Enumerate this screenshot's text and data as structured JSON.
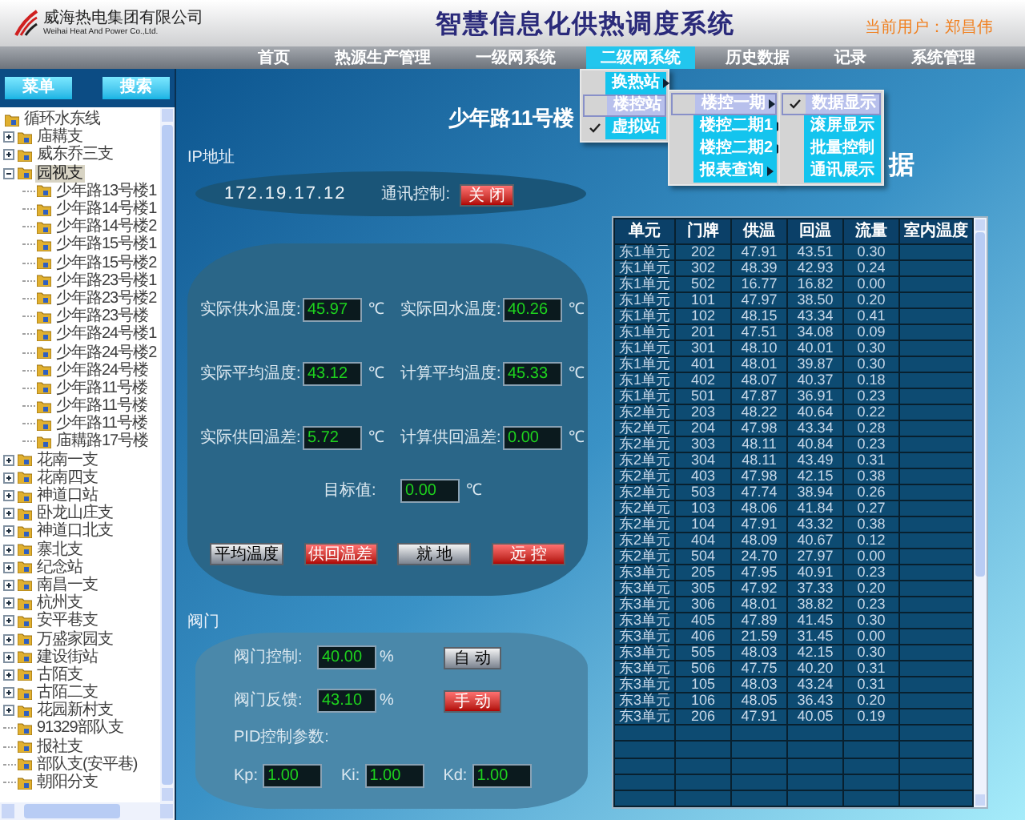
{
  "header": {
    "company_name": "威海热电集团有限公司",
    "company_name_en": "Weihai Heat And Power Co.,Ltd.",
    "title": "智慧信息化供热调度系统",
    "current_user": "当前用户：郑昌伟"
  },
  "nav": [
    {
      "label": "首页",
      "selected": false
    },
    {
      "label": "热源生产管理",
      "selected": false
    },
    {
      "label": "一级网系统",
      "selected": false
    },
    {
      "label": "二级网系统",
      "selected": true
    },
    {
      "label": "历史数据",
      "selected": false
    },
    {
      "label": "记录",
      "selected": false
    },
    {
      "label": "系统管理",
      "selected": false
    }
  ],
  "menus": [
    {
      "items": [
        {
          "label": "换热站",
          "selected": false,
          "checked": false,
          "submenu": true
        },
        {
          "label": "楼控站",
          "selected": true,
          "checked": false,
          "submenu": false
        },
        {
          "label": "虚拟站",
          "selected": false,
          "checked": true,
          "submenu": false
        }
      ]
    },
    {
      "items": [
        {
          "label": "楼控一期",
          "selected": true,
          "checked": false,
          "submenu": true
        },
        {
          "label": "楼控二期1",
          "selected": false,
          "checked": false,
          "submenu": true
        },
        {
          "label": "楼控二期2",
          "selected": false,
          "checked": false,
          "submenu": true
        },
        {
          "label": "报表查询",
          "selected": false,
          "checked": false,
          "submenu": true
        }
      ]
    },
    {
      "items": [
        {
          "label": "数据显示",
          "selected": true,
          "checked": true,
          "submenu": false
        },
        {
          "label": "滚屏显示",
          "selected": false,
          "checked": false,
          "submenu": false
        },
        {
          "label": "批量控制",
          "selected": false,
          "checked": false,
          "submenu": false
        },
        {
          "label": "通讯展示",
          "selected": false,
          "checked": false,
          "submenu": false
        }
      ]
    }
  ],
  "sidebar": {
    "buttons": [
      "菜单",
      "搜索"
    ],
    "tree": {
      "label": "循环水东线",
      "selected": false,
      "children": [
        {
          "label": "庙耩支",
          "kind": "branch",
          "expanded": false,
          "selected": false
        },
        {
          "label": "威东乔三支",
          "kind": "branch",
          "expanded": false,
          "selected": false
        },
        {
          "label": "园视支",
          "kind": "branch",
          "expanded": true,
          "selected": true,
          "children": [
            {
              "label": "少年路13号楼1",
              "kind": "leaf",
              "selected": false
            },
            {
              "label": "少年路14号楼1",
              "kind": "leaf",
              "selected": false
            },
            {
              "label": "少年路14号楼2",
              "kind": "leaf",
              "selected": false
            },
            {
              "label": "少年路15号楼1",
              "kind": "leaf",
              "selected": false
            },
            {
              "label": "少年路15号楼2",
              "kind": "leaf",
              "selected": false
            },
            {
              "label": "少年路23号楼1",
              "kind": "leaf",
              "selected": false
            },
            {
              "label": "少年路23号楼2",
              "kind": "leaf",
              "selected": false
            },
            {
              "label": "少年路23号楼",
              "kind": "leaf",
              "selected": false
            },
            {
              "label": "少年路24号楼1",
              "kind": "leaf",
              "selected": false
            },
            {
              "label": "少年路24号楼2",
              "kind": "leaf",
              "selected": false
            },
            {
              "label": "少年路24号楼",
              "kind": "leaf",
              "selected": false
            },
            {
              "label": "少年路11号楼",
              "kind": "leaf",
              "selected": false
            },
            {
              "label": "少年路11号楼",
              "kind": "leaf",
              "selected": false
            },
            {
              "label": "少年路11号楼",
              "kind": "leaf",
              "selected": false
            },
            {
              "label": "庙耩路17号楼",
              "kind": "leaf",
              "selected": false
            }
          ]
        },
        {
          "label": "花南一支",
          "kind": "branch",
          "expanded": false,
          "selected": false
        },
        {
          "label": "花南四支",
          "kind": "branch",
          "expanded": false,
          "selected": false
        },
        {
          "label": "神道口站",
          "kind": "branch",
          "expanded": false,
          "selected": false
        },
        {
          "label": "卧龙山庄支",
          "kind": "branch",
          "expanded": false,
          "selected": false
        },
        {
          "label": "神道口北支",
          "kind": "branch",
          "expanded": false,
          "selected": false
        },
        {
          "label": "寨北支",
          "kind": "branch",
          "expanded": false,
          "selected": false
        },
        {
          "label": "纪念站",
          "kind": "branch",
          "expanded": false,
          "selected": false
        },
        {
          "label": "南昌一支",
          "kind": "branch",
          "expanded": false,
          "selected": false
        },
        {
          "label": "杭州支",
          "kind": "branch",
          "expanded": false,
          "selected": false
        },
        {
          "label": "安平巷支",
          "kind": "branch",
          "expanded": false,
          "selected": false
        },
        {
          "label": "万盛家园支",
          "kind": "branch",
          "expanded": false,
          "selected": false
        },
        {
          "label": "建设街站",
          "kind": "branch",
          "expanded": false,
          "selected": false
        },
        {
          "label": "古陌支",
          "kind": "branch",
          "expanded": false,
          "selected": false
        },
        {
          "label": "古陌二支",
          "kind": "branch",
          "expanded": false,
          "selected": false
        },
        {
          "label": "花园新村支",
          "kind": "branch",
          "expanded": false,
          "selected": false
        },
        {
          "label": "91329部队支",
          "kind": "leaf",
          "selected": false
        },
        {
          "label": "报社支",
          "kind": "leaf",
          "selected": false
        },
        {
          "label": "部队支(安平巷)",
          "kind": "leaf",
          "selected": false
        },
        {
          "label": "朝阳分支",
          "kind": "leaf",
          "selected": false
        }
      ]
    }
  },
  "page_title": "少年路11号楼",
  "title_fragment": "据",
  "ip": {
    "label": "IP地址",
    "address": "172.19.17.12",
    "control_label": "通讯控制:",
    "button": {
      "label": "关 闭",
      "active": true
    }
  },
  "temperatures": {
    "fields": [
      {
        "label": "实际供水温度:",
        "value": "45.97",
        "unit": "℃"
      },
      {
        "label": "实际回水温度:",
        "value": "40.26",
        "unit": "℃"
      },
      {
        "label": "实际平均温度:",
        "value": "43.12",
        "unit": "℃"
      },
      {
        "label": "计算平均温度:",
        "value": "45.33",
        "unit": "℃"
      },
      {
        "label": "实际供回温差:",
        "value": "5.72",
        "unit": "℃"
      },
      {
        "label": "计算供回温差:",
        "value": "0.00",
        "unit": "℃"
      }
    ],
    "target": {
      "label": "目标值:",
      "value": "0.00",
      "unit": "℃"
    },
    "buttons": [
      {
        "label": "平均温度",
        "active": false
      },
      {
        "label": "供回温差",
        "active": true
      },
      {
        "label": "就 地",
        "active": false
      },
      {
        "label": "远 控",
        "active": true
      }
    ]
  },
  "valve": {
    "title": "阀门",
    "rows": [
      {
        "label": "阀门控制:",
        "value": "40.00",
        "unit": "%",
        "button": {
          "label": "自 动",
          "active": false
        }
      },
      {
        "label": "阀门反馈:",
        "value": "43.10",
        "unit": "%",
        "button": {
          "label": "手 动",
          "active": true
        }
      }
    ],
    "pid_label": "PID控制参数:",
    "pid": [
      {
        "label": "Kp:",
        "value": "1.00"
      },
      {
        "label": "Ki:",
        "value": "1.00"
      },
      {
        "label": "Kd:",
        "value": "1.00"
      }
    ]
  },
  "table": {
    "columns": [
      "单元",
      "门牌",
      "供温",
      "回温",
      "流量",
      "室内温度"
    ],
    "rows": [
      [
        "东1单元",
        "202",
        "47.91",
        "43.51",
        "0.30"
      ],
      [
        "东1单元",
        "302",
        "48.39",
        "42.93",
        "0.24"
      ],
      [
        "东1单元",
        "502",
        "16.77",
        "16.82",
        "0.00"
      ],
      [
        "东1单元",
        "101",
        "47.97",
        "38.50",
        "0.20"
      ],
      [
        "东1单元",
        "102",
        "48.15",
        "43.34",
        "0.41"
      ],
      [
        "东1单元",
        "201",
        "47.51",
        "34.08",
        "0.09"
      ],
      [
        "东1单元",
        "301",
        "48.10",
        "40.01",
        "0.30"
      ],
      [
        "东1单元",
        "401",
        "48.01",
        "39.87",
        "0.30"
      ],
      [
        "东1单元",
        "402",
        "48.07",
        "40.37",
        "0.18"
      ],
      [
        "东1单元",
        "501",
        "47.87",
        "36.91",
        "0.23"
      ],
      [
        "东2单元",
        "203",
        "48.22",
        "40.64",
        "0.22"
      ],
      [
        "东2单元",
        "204",
        "47.98",
        "43.34",
        "0.28"
      ],
      [
        "东2单元",
        "303",
        "48.11",
        "40.84",
        "0.23"
      ],
      [
        "东2单元",
        "304",
        "48.11",
        "43.49",
        "0.31"
      ],
      [
        "东2单元",
        "403",
        "47.98",
        "42.15",
        "0.38"
      ],
      [
        "东2单元",
        "503",
        "47.74",
        "38.94",
        "0.26"
      ],
      [
        "东2单元",
        "103",
        "48.06",
        "41.84",
        "0.27"
      ],
      [
        "东2单元",
        "104",
        "47.91",
        "43.32",
        "0.38"
      ],
      [
        "东2单元",
        "404",
        "48.09",
        "40.67",
        "0.12"
      ],
      [
        "东2单元",
        "504",
        "24.70",
        "27.97",
        "0.00"
      ],
      [
        "东3单元",
        "205",
        "47.95",
        "40.91",
        "0.23"
      ],
      [
        "东3单元",
        "305",
        "47.92",
        "37.33",
        "0.20"
      ],
      [
        "东3单元",
        "306",
        "48.01",
        "38.82",
        "0.23"
      ],
      [
        "东3单元",
        "405",
        "47.89",
        "41.45",
        "0.30"
      ],
      [
        "东3单元",
        "406",
        "21.59",
        "31.45",
        "0.00"
      ],
      [
        "东3单元",
        "505",
        "48.03",
        "42.15",
        "0.30"
      ],
      [
        "东3单元",
        "506",
        "47.75",
        "40.20",
        "0.31"
      ],
      [
        "东3单元",
        "105",
        "48.03",
        "43.24",
        "0.31"
      ],
      [
        "东3单元",
        "106",
        "48.05",
        "36.43",
        "0.20"
      ],
      [
        "东3单元",
        "206",
        "47.91",
        "40.05",
        "0.19"
      ]
    ]
  }
}
